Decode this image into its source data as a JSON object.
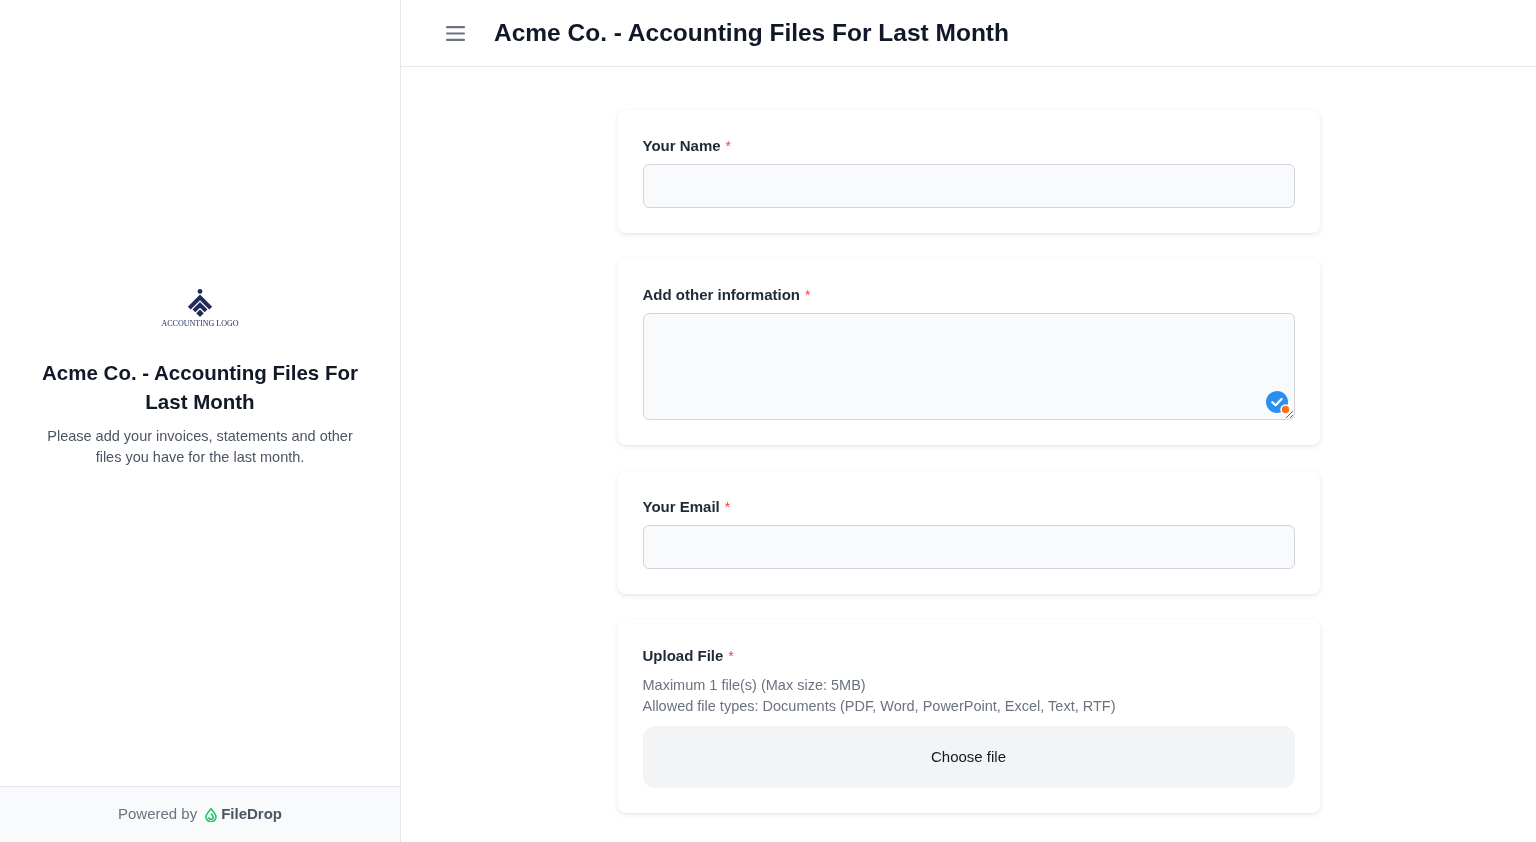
{
  "sidebar": {
    "logo_caption": "ACCOUNTING LOGO",
    "title": "Acme Co. - Accounting Files For Last Month",
    "description": "Please add your invoices, statements and other files you have for the last month.",
    "footer": {
      "prefix": "Powered by",
      "brand": "FileDrop"
    }
  },
  "header": {
    "title": "Acme Co. - Accounting Files For Last Month"
  },
  "fields": [
    {
      "kind": "text",
      "label": "Your Name",
      "required_mark": "*"
    },
    {
      "kind": "textarea",
      "label": "Add other information",
      "required_mark": "*"
    },
    {
      "kind": "email",
      "label": "Your Email",
      "required_mark": "*"
    },
    {
      "kind": "file",
      "label": "Upload File",
      "required_mark": "*",
      "notes": [
        "Maximum 1 file(s) (Max size: 5MB)",
        "Allowed file types: Documents (PDF, Word, PowerPoint, Excel, Text, RTF)"
      ],
      "button": "Choose file"
    }
  ]
}
